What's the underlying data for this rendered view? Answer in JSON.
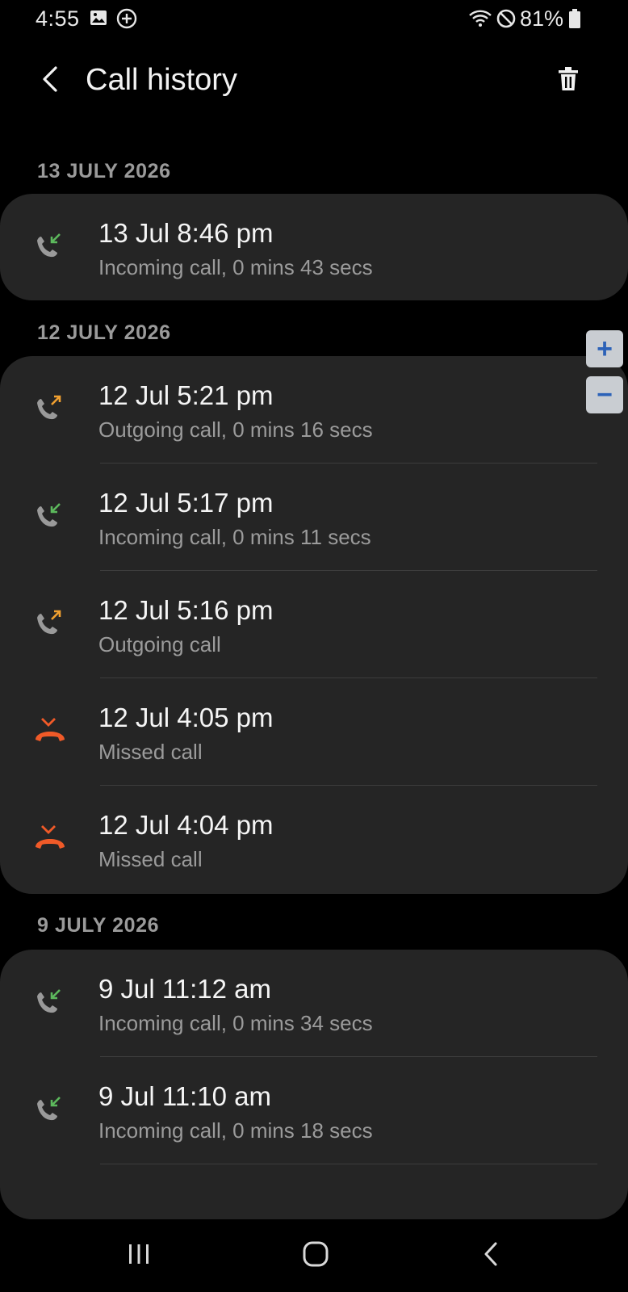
{
  "status_bar": {
    "time": "4:55",
    "battery": "81%",
    "icons": [
      "image-icon",
      "add-circle-icon",
      "wifi-icon",
      "do-not-disturb-icon",
      "battery-icon"
    ]
  },
  "header": {
    "title": "Call history",
    "back_icon": "back-arrow-icon",
    "delete_icon": "trash-icon"
  },
  "colors": {
    "background": "#000000",
    "card": "#252525",
    "incoming": "#5cb85c",
    "outgoing": "#f0a030",
    "missed": "#f05a28"
  },
  "sections": [
    {
      "date": "13 JULY 2026",
      "calls": [
        {
          "time": "13 Jul 8:46 pm",
          "detail": "Incoming call, 0 mins 43 secs",
          "type": "incoming"
        }
      ]
    },
    {
      "date": "12 JULY 2026",
      "calls": [
        {
          "time": "12 Jul 5:21 pm",
          "detail": "Outgoing call, 0 mins 16 secs",
          "type": "outgoing"
        },
        {
          "time": "12 Jul 5:17 pm",
          "detail": "Incoming call, 0 mins 11 secs",
          "type": "incoming"
        },
        {
          "time": "12 Jul 5:16 pm",
          "detail": "Outgoing call",
          "type": "outgoing"
        },
        {
          "time": "12 Jul 4:05 pm",
          "detail": "Missed call",
          "type": "missed"
        },
        {
          "time": "12 Jul 4:04 pm",
          "detail": "Missed call",
          "type": "missed"
        }
      ]
    },
    {
      "date": "9 JULY 2026",
      "calls": [
        {
          "time": "9 Jul 11:12 am",
          "detail": "Incoming call, 0 mins 34 secs",
          "type": "incoming"
        },
        {
          "time": "9 Jul 11:10 am",
          "detail": "Incoming call, 0 mins 18 secs",
          "type": "incoming"
        }
      ]
    }
  ],
  "zoom": {
    "plus": "+",
    "minus": "−"
  },
  "nav": {
    "recents": "recents-icon",
    "home": "home-icon",
    "back": "back-icon"
  }
}
